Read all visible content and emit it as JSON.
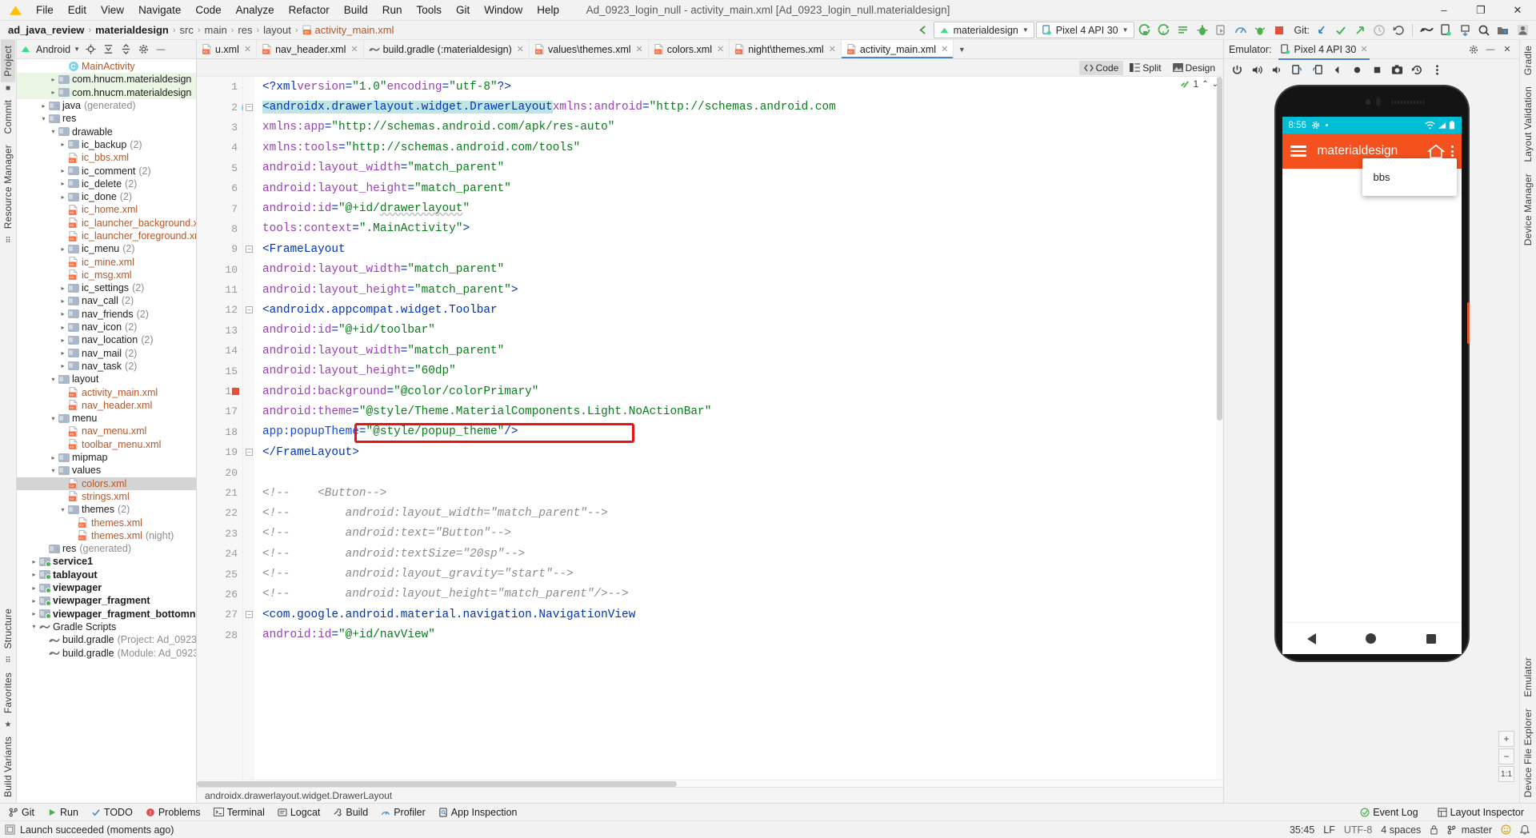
{
  "titlebar": {
    "logo_icon": "android-logo-icon",
    "menus": [
      "File",
      "Edit",
      "View",
      "Navigate",
      "Code",
      "Analyze",
      "Refactor",
      "Build",
      "Run",
      "Tools",
      "Git",
      "Window",
      "Help"
    ],
    "window_title": "Ad_0923_login_null - activity_main.xml [Ad_0923_login_null.materialdesign]",
    "minimize": "–",
    "maximize": "❐",
    "close": "✕"
  },
  "breadcrumb": {
    "items": [
      "ad_java_review",
      "materialdesign",
      "src",
      "main",
      "res",
      "layout",
      "activity_main.xml"
    ],
    "separator": "›"
  },
  "main_toolbar": {
    "back_icon": "back-arrow-icon",
    "run_config": "materialdesign",
    "device": "Pixel 4 API 30",
    "buttons": [
      "run-icon",
      "run-coverage-icon",
      "apply-changes-icon",
      "debug-icon",
      "profile-app-icon",
      "profiler-icon",
      "run-with-coverage-icon",
      "stop-icon"
    ],
    "git_label": "Git:",
    "git_buttons": [
      "update-project-icon",
      "commit-icon",
      "push-icon",
      "history-icon",
      "undo-icon"
    ],
    "right_buttons": [
      "sdk-manager-icon",
      "avd-manager-icon",
      "device-explorer-icon",
      "search-icon",
      "project-structure-icon",
      "account-icon"
    ]
  },
  "left_strip": {
    "tabs": [
      "Project",
      "Commit",
      "Resource Manager"
    ],
    "bottom_tabs": [
      "Structure",
      "Favorites",
      "Build Variants"
    ],
    "selected": "Project"
  },
  "right_strip": {
    "tabs": [
      "Gradle",
      "Layout Validation",
      "Device Manager",
      "Emulator",
      "Device File Explorer"
    ]
  },
  "project_panel": {
    "title": "Android",
    "header_icons": [
      "locate-icon",
      "expand-all-icon",
      "collapse-all-icon",
      "settings-icon",
      "hide-icon"
    ],
    "tree": [
      {
        "indent": 4,
        "arrow": "none",
        "icon": "class-icon",
        "label": "MainActivity",
        "count": "",
        "style": "file"
      },
      {
        "indent": 3,
        "arrow": "right",
        "icon": "folder",
        "label": "com.hnucm.materialdesign",
        "count": "",
        "style": "green"
      },
      {
        "indent": 3,
        "arrow": "right",
        "icon": "folder",
        "label": "com.hnucm.materialdesign",
        "count": "",
        "style": "green"
      },
      {
        "indent": 2,
        "arrow": "right",
        "icon": "folder-java",
        "label": "java",
        "count": "(generated)",
        "style": ""
      },
      {
        "indent": 2,
        "arrow": "down",
        "icon": "folder-res",
        "label": "res",
        "count": "",
        "style": ""
      },
      {
        "indent": 3,
        "arrow": "down",
        "icon": "folder",
        "label": "drawable",
        "count": "",
        "style": ""
      },
      {
        "indent": 4,
        "arrow": "right",
        "icon": "folder",
        "label": "ic_backup",
        "count": "(2)",
        "style": ""
      },
      {
        "indent": 4,
        "arrow": "none",
        "icon": "xml",
        "label": "ic_bbs.xml",
        "count": "",
        "style": "file"
      },
      {
        "indent": 4,
        "arrow": "right",
        "icon": "folder",
        "label": "ic_comment",
        "count": "(2)",
        "style": ""
      },
      {
        "indent": 4,
        "arrow": "right",
        "icon": "folder",
        "label": "ic_delete",
        "count": "(2)",
        "style": ""
      },
      {
        "indent": 4,
        "arrow": "right",
        "icon": "folder",
        "label": "ic_done",
        "count": "(2)",
        "style": ""
      },
      {
        "indent": 4,
        "arrow": "none",
        "icon": "xml",
        "label": "ic_home.xml",
        "count": "",
        "style": "file"
      },
      {
        "indent": 4,
        "arrow": "none",
        "icon": "xml",
        "label": "ic_launcher_background.xml",
        "count": "",
        "style": "file"
      },
      {
        "indent": 4,
        "arrow": "none",
        "icon": "xml",
        "label": "ic_launcher_foreground.xml",
        "count": "",
        "style": "file"
      },
      {
        "indent": 4,
        "arrow": "right",
        "icon": "folder",
        "label": "ic_menu",
        "count": "(2)",
        "style": ""
      },
      {
        "indent": 4,
        "arrow": "none",
        "icon": "xml",
        "label": "ic_mine.xml",
        "count": "",
        "style": "file"
      },
      {
        "indent": 4,
        "arrow": "none",
        "icon": "xml",
        "label": "ic_msg.xml",
        "count": "",
        "style": "file"
      },
      {
        "indent": 4,
        "arrow": "right",
        "icon": "folder",
        "label": "ic_settings",
        "count": "(2)",
        "style": ""
      },
      {
        "indent": 4,
        "arrow": "right",
        "icon": "folder",
        "label": "nav_call",
        "count": "(2)",
        "style": ""
      },
      {
        "indent": 4,
        "arrow": "right",
        "icon": "folder",
        "label": "nav_friends",
        "count": "(2)",
        "style": ""
      },
      {
        "indent": 4,
        "arrow": "right",
        "icon": "folder",
        "label": "nav_icon",
        "count": "(2)",
        "style": ""
      },
      {
        "indent": 4,
        "arrow": "right",
        "icon": "folder",
        "label": "nav_location",
        "count": "(2)",
        "style": ""
      },
      {
        "indent": 4,
        "arrow": "right",
        "icon": "folder",
        "label": "nav_mail",
        "count": "(2)",
        "style": ""
      },
      {
        "indent": 4,
        "arrow": "right",
        "icon": "folder",
        "label": "nav_task",
        "count": "(2)",
        "style": ""
      },
      {
        "indent": 3,
        "arrow": "down",
        "icon": "folder",
        "label": "layout",
        "count": "",
        "style": ""
      },
      {
        "indent": 4,
        "arrow": "none",
        "icon": "xml",
        "label": "activity_main.xml",
        "count": "",
        "style": "file"
      },
      {
        "indent": 4,
        "arrow": "none",
        "icon": "xml",
        "label": "nav_header.xml",
        "count": "",
        "style": "file"
      },
      {
        "indent": 3,
        "arrow": "down",
        "icon": "folder",
        "label": "menu",
        "count": "",
        "style": ""
      },
      {
        "indent": 4,
        "arrow": "none",
        "icon": "xml",
        "label": "nav_menu.xml",
        "count": "",
        "style": "file"
      },
      {
        "indent": 4,
        "arrow": "none",
        "icon": "xml",
        "label": "toolbar_menu.xml",
        "count": "",
        "style": "file"
      },
      {
        "indent": 3,
        "arrow": "right",
        "icon": "folder",
        "label": "mipmap",
        "count": "",
        "style": ""
      },
      {
        "indent": 3,
        "arrow": "down",
        "icon": "folder",
        "label": "values",
        "count": "",
        "style": ""
      },
      {
        "indent": 4,
        "arrow": "none",
        "icon": "xml",
        "label": "colors.xml",
        "count": "",
        "style": "file selected"
      },
      {
        "indent": 4,
        "arrow": "none",
        "icon": "xml",
        "label": "strings.xml",
        "count": "",
        "style": "file"
      },
      {
        "indent": 4,
        "arrow": "down",
        "icon": "folder",
        "label": "themes",
        "count": "(2)",
        "style": ""
      },
      {
        "indent": 5,
        "arrow": "none",
        "icon": "xml",
        "label": "themes.xml",
        "count": "",
        "style": "file"
      },
      {
        "indent": 5,
        "arrow": "none",
        "icon": "xml",
        "label": "themes.xml",
        "count": "(night)",
        "style": "file"
      },
      {
        "indent": 2,
        "arrow": "none",
        "icon": "folder-res",
        "label": "res",
        "count": "(generated)",
        "style": ""
      },
      {
        "indent": 1,
        "arrow": "right",
        "icon": "folder-module",
        "label": "service1",
        "count": "",
        "style": "bold"
      },
      {
        "indent": 1,
        "arrow": "right",
        "icon": "folder-module",
        "label": "tablayout",
        "count": "",
        "style": "bold"
      },
      {
        "indent": 1,
        "arrow": "right",
        "icon": "folder-module",
        "label": "viewpager",
        "count": "",
        "style": "bold"
      },
      {
        "indent": 1,
        "arrow": "right",
        "icon": "folder-module",
        "label": "viewpager_fragment",
        "count": "",
        "style": "bold"
      },
      {
        "indent": 1,
        "arrow": "right",
        "icon": "folder-module",
        "label": "viewpager_fragment_bottomnav",
        "count": "",
        "style": "bold"
      },
      {
        "indent": 1,
        "arrow": "down",
        "icon": "gradle",
        "label": "Gradle Scripts",
        "count": "",
        "style": ""
      },
      {
        "indent": 2,
        "arrow": "none",
        "icon": "gradle",
        "label": "build.gradle",
        "count": "(Project: Ad_0923",
        "style": ""
      },
      {
        "indent": 2,
        "arrow": "none",
        "icon": "gradle",
        "label": "build.gradle",
        "count": "(Module: Ad_0923",
        "style": ""
      }
    ]
  },
  "editor": {
    "tabs": [
      {
        "label": "u.xml",
        "icon": "xml",
        "active": false
      },
      {
        "label": "nav_header.xml",
        "icon": "xml",
        "active": false
      },
      {
        "label": "build.gradle (:materialdesign)",
        "icon": "gradle",
        "active": false
      },
      {
        "label": "values\\themes.xml",
        "icon": "xml",
        "active": false
      },
      {
        "label": "colors.xml",
        "icon": "xml",
        "active": false
      },
      {
        "label": "night\\themes.xml",
        "icon": "xml",
        "active": false
      },
      {
        "label": "activity_main.xml",
        "icon": "xml",
        "active": true
      }
    ],
    "modes": [
      "Code",
      "Split",
      "Design"
    ],
    "selected_mode": "Code",
    "inspection_count": "1",
    "footer_breadcrumb": "androidx.drawerlayout.widget.DrawerLayout",
    "lines": [
      {
        "n": 1,
        "html": "<span class='pi'>&lt;?xml</span> <span class='attr'>version</span><span class='punct'>=</span><span class='str'>\"1.0\"</span> <span class='attr'>encoding</span><span class='punct'>=</span><span class='str'>\"utf-8\"</span><span class='pi'>?&gt;</span>"
      },
      {
        "n": 2,
        "html": "<span class='tag hl'>&lt;androidx.drawerlayout.widget.DrawerLayout</span> <span class='attr'>xmlns:android</span><span class='punct'>=</span><span class='str'>\"http://schemas.android.com</span>"
      },
      {
        "n": 3,
        "html": "    <span class='attr'>xmlns:app</span><span class='punct'>=</span><span class='str'>\"http://schemas.android.com/apk/res-auto\"</span>"
      },
      {
        "n": 4,
        "html": "    <span class='attr'>xmlns:tools</span><span class='punct'>=</span><span class='str'>\"http://schemas.android.com/tools\"</span>"
      },
      {
        "n": 5,
        "html": "    <span class='attr'>android:layout_width</span><span class='punct'>=</span><span class='str'>\"match_parent\"</span>"
      },
      {
        "n": 6,
        "html": "    <span class='attr'>android:layout_height</span><span class='punct'>=</span><span class='str'>\"match_parent\"</span>"
      },
      {
        "n": 7,
        "html": "    <span class='attr'>android:id</span><span class='punct'>=</span><span class='str'>\"@+id/</span><span class='str wavy'>drawerlayout</span><span class='str'>\"</span>"
      },
      {
        "n": 8,
        "html": "    <span class='attr'>tools:context</span><span class='punct'>=</span><span class='str'>\".MainActivity\"</span><span class='tag'>&gt;</span>"
      },
      {
        "n": 9,
        "html": "    <span class='tag'>&lt;FrameLayout</span>"
      },
      {
        "n": 10,
        "html": "        <span class='attr'>android:layout_width</span><span class='punct'>=</span><span class='str'>\"match_parent\"</span>"
      },
      {
        "n": 11,
        "html": "        <span class='attr'>android:layout_height</span><span class='punct'>=</span><span class='str'>\"match_parent\"</span><span class='tag'>&gt;</span>"
      },
      {
        "n": 12,
        "html": "        <span class='tag'>&lt;androidx.appcompat.widget.Toolbar</span>"
      },
      {
        "n": 13,
        "html": "            <span class='attr'>android:id</span><span class='punct'>=</span><span class='str'>\"@+id/toolbar\"</span>"
      },
      {
        "n": 14,
        "html": "            <span class='attr'>android:layout_width</span><span class='punct'>=</span><span class='str'>\"match_parent\"</span>"
      },
      {
        "n": 15,
        "html": "            <span class='attr'>android:layout_height</span><span class='punct'>=</span><span class='str'>\"60dp\"</span>"
      },
      {
        "n": 16,
        "html": "            <span class='attr'>android:background</span><span class='punct'>=</span><span class='str'>\"@color/colorPrimary\"</span>"
      },
      {
        "n": 17,
        "html": "            <span class='attr'>android:theme</span><span class='punct'>=</span><span class='str'>\"@style/Theme.MaterialComponents.Light.NoActionBar\"</span>"
      },
      {
        "n": 18,
        "html": "            <span class='attr2'>app:popupTheme</span><span class='punct'>=</span><span class='str'>\"@style/popup_theme\"</span><span class='tag'>/&gt;</span>"
      },
      {
        "n": 19,
        "html": "    <span class='tag'>&lt;/FrameLayout&gt;</span>"
      },
      {
        "n": 20,
        "html": ""
      },
      {
        "n": 21,
        "html": "<span class='cmt'>&lt;!--    &lt;Button--&gt;</span>"
      },
      {
        "n": 22,
        "html": "<span class='cmt'>&lt;!--        android:layout_width=\"match_parent\"--&gt;</span>"
      },
      {
        "n": 23,
        "html": "<span class='cmt'>&lt;!--        android:text=\"Button\"--&gt;</span>"
      },
      {
        "n": 24,
        "html": "<span class='cmt'>&lt;!--        android:textSize=\"20sp\"--&gt;</span>"
      },
      {
        "n": 25,
        "html": "<span class='cmt'>&lt;!--        android:layout_gravity=\"start\"--&gt;</span>"
      },
      {
        "n": 26,
        "html": "<span class='cmt'>&lt;!--        android:layout_height=\"match_parent\"/&gt;--&gt;</span>"
      },
      {
        "n": 27,
        "html": "    <span class='tag'>&lt;com.google.android.material.navigation.NavigationView</span>"
      },
      {
        "n": 28,
        "html": "        <span class='attr'>android:id</span><span class='punct'>=</span><span class='str'>\"@+id/navView\"</span>"
      }
    ]
  },
  "emulator": {
    "label": "Emulator:",
    "device_tab": "Pixel 4 API 30",
    "toolbar_icons": [
      "power-icon",
      "volume-up-icon",
      "volume-down-icon",
      "rotate-left-icon",
      "rotate-right-icon",
      "back-icon",
      "home-icon",
      "overview-icon",
      "screenshot-icon",
      "history-icon",
      "more-icon"
    ],
    "zoom_controls": [
      "+",
      "−",
      "1:1"
    ],
    "phone": {
      "status_time": "8:56",
      "status_icons": [
        "gear-icon",
        "dot-icon"
      ],
      "status_right_icons": [
        "wifi-icon",
        "signal-icon",
        "battery-icon"
      ],
      "appbar_title": "materialdesign",
      "appbar_actions": [
        "home-action-icon",
        "overflow-menu-icon"
      ],
      "popup_items": [
        "bbs"
      ],
      "nav_buttons": [
        "back-nav-icon",
        "home-nav-icon",
        "recents-nav-icon"
      ]
    }
  },
  "bottom_toolwindows": {
    "items": [
      {
        "label": "Git",
        "icon": "git-icon"
      },
      {
        "label": "Run",
        "icon": "run-icon"
      },
      {
        "label": "TODO",
        "icon": "todo-icon"
      },
      {
        "label": "Problems",
        "icon": "problems-icon"
      },
      {
        "label": "Terminal",
        "icon": "terminal-icon"
      },
      {
        "label": "Logcat",
        "icon": "logcat-icon"
      },
      {
        "label": "Build",
        "icon": "build-icon"
      },
      {
        "label": "Profiler",
        "icon": "profiler-icon"
      },
      {
        "label": "App Inspection",
        "icon": "app-inspection-icon"
      }
    ],
    "right_items": [
      {
        "label": "Event Log",
        "icon": "event-log-icon"
      },
      {
        "label": "Layout Inspector",
        "icon": "layout-inspector-icon"
      }
    ]
  },
  "statusbar": {
    "message": "Launch succeeded (moments ago)",
    "message_icon": "info-icon",
    "caret": "35:45",
    "line_sep": "LF",
    "encoding": "UTF-8",
    "indent": "4 spaces",
    "branch": "master",
    "branch_icon": "git-branch-icon",
    "lock_icon": "lock-icon",
    "right_icons": [
      "smiley-icon",
      "notification-icon"
    ]
  }
}
